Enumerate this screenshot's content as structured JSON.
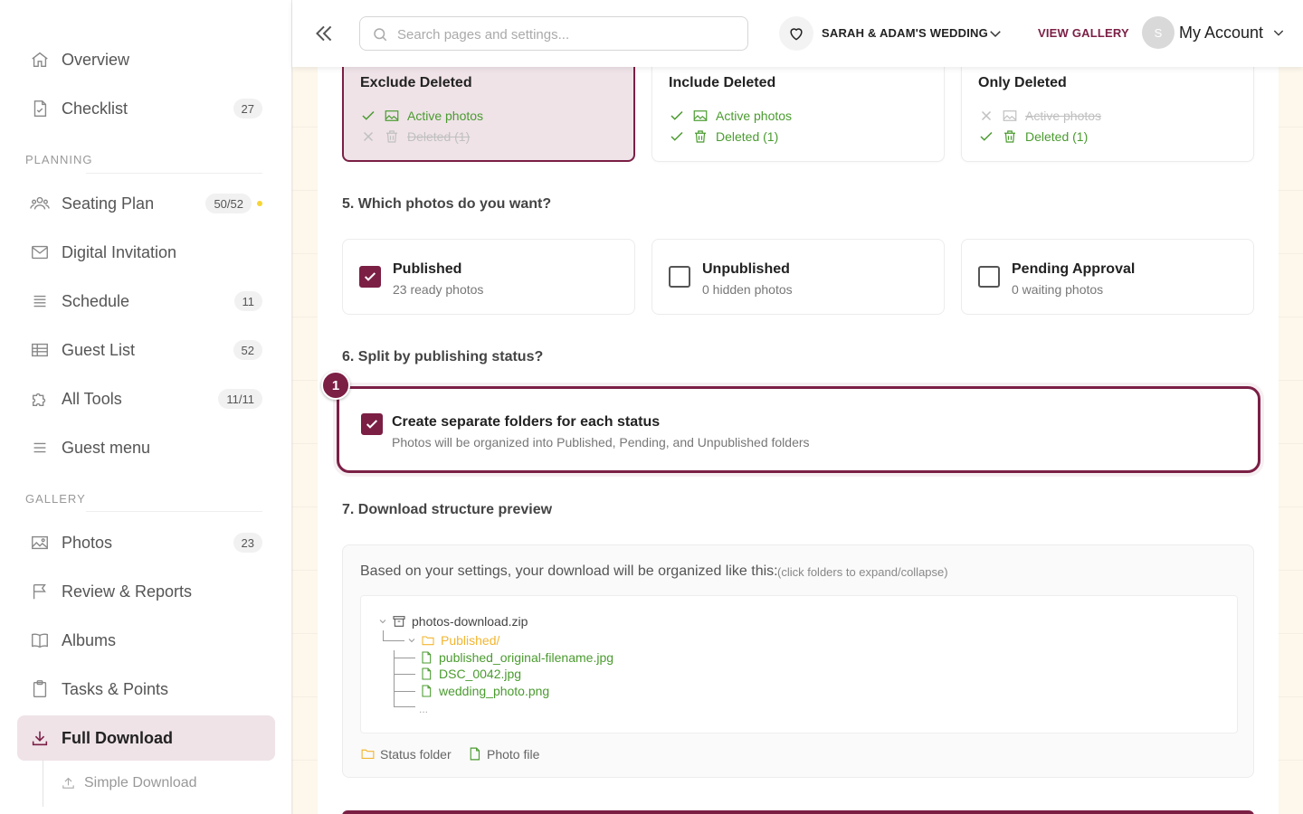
{
  "sidebar": {
    "items": [
      {
        "label": "Overview",
        "icon": "home-icon",
        "badge": ""
      },
      {
        "label": "Checklist",
        "icon": "checklist-icon",
        "badge": "27"
      },
      {
        "label": "Seating Plan",
        "icon": "people-icon",
        "badge": "50/52"
      },
      {
        "label": "Digital Invitation",
        "icon": "mail-icon",
        "badge": ""
      },
      {
        "label": "Schedule",
        "icon": "schedule-icon",
        "badge": "11"
      },
      {
        "label": "Guest List",
        "icon": "table-icon",
        "badge": "52"
      },
      {
        "label": "All Tools",
        "icon": "puzzle-icon",
        "badge": "11/11"
      },
      {
        "label": "Guest menu",
        "icon": "menu-icon",
        "badge": ""
      },
      {
        "label": "Photos",
        "icon": "image-icon",
        "badge": "23"
      },
      {
        "label": "Review & Reports",
        "icon": "flag-icon",
        "badge": ""
      },
      {
        "label": "Albums",
        "icon": "book-icon",
        "badge": ""
      },
      {
        "label": "Tasks & Points",
        "icon": "clipboard-icon",
        "badge": ""
      },
      {
        "label": "Full Download",
        "icon": "download-icon",
        "badge": ""
      }
    ],
    "sections": {
      "planning": "PLANNING",
      "gallery": "GALLERY"
    },
    "sub_item": "Simple Download",
    "status_dot_color": "#f6d533"
  },
  "topbar": {
    "search_placeholder": "Search pages and settings...",
    "event_name": "SARAH & ADAM'S WEDDING",
    "view_gallery": "VIEW GALLERY",
    "avatar_initial": "S",
    "account_label": "My Account"
  },
  "deleted_options": [
    {
      "title": "Exclude Deleted",
      "active": "Active photos",
      "deleted": "Deleted (1)",
      "active_on": true,
      "deleted_on": false,
      "selected": true
    },
    {
      "title": "Include Deleted",
      "active": "Active photos",
      "deleted": "Deleted (1)",
      "active_on": true,
      "deleted_on": true,
      "selected": false
    },
    {
      "title": "Only Deleted",
      "active": "Active photos",
      "deleted": "Deleted (1)",
      "active_on": false,
      "deleted_on": true,
      "selected": false
    }
  ],
  "q5": {
    "label": "5. Which photos do you want?",
    "options": [
      {
        "title": "Published",
        "sub": "23 ready photos",
        "checked": true
      },
      {
        "title": "Unpublished",
        "sub": "0 hidden photos",
        "checked": false
      },
      {
        "title": "Pending Approval",
        "sub": "0 waiting photos",
        "checked": false
      }
    ]
  },
  "q6": {
    "label": "6. Split by publishing status?",
    "step": "1",
    "title": "Create separate folders for each status",
    "sub": "Photos will be organized into Published, Pending, and Unpublished folders",
    "checked": true
  },
  "q7": {
    "label": "7. Download structure preview",
    "head": "Based on your settings, your download will be organized like this:",
    "hint": "(click folders to expand/collapse)",
    "root": "photos-download.zip",
    "folder": "Published/",
    "files": [
      "published_original-filename.jpg",
      "DSC_0042.jpg",
      "wedding_photo.png"
    ],
    "ellipsis": "...",
    "legend_folder": "Status folder",
    "legend_file": "Photo file"
  },
  "colors": {
    "accent": "#7b1f45",
    "accent_bg": "#efe3e8",
    "success": "#4a9b2f",
    "folder": "#f2b630"
  }
}
